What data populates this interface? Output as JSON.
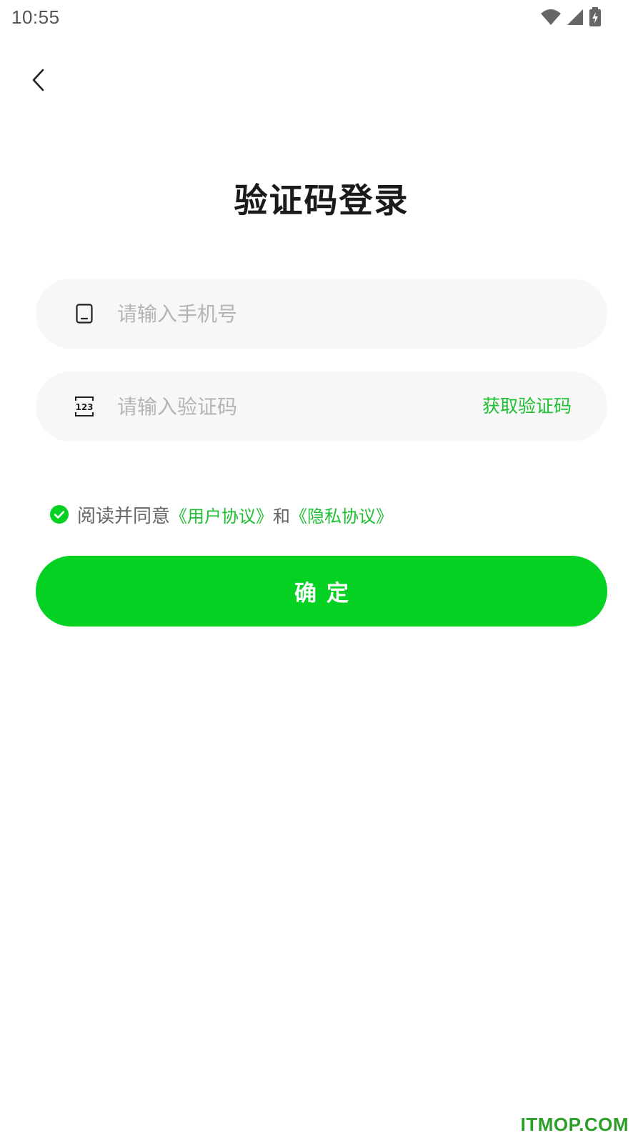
{
  "status_bar": {
    "time": "10:55",
    "icons": [
      "wifi-icon",
      "cellular-signal-icon",
      "battery-charging-icon"
    ]
  },
  "header": {
    "back_icon": "chevron-left-icon"
  },
  "title": "验证码登录",
  "phone_field": {
    "icon": "phone-icon",
    "placeholder": "请输入手机号",
    "value": ""
  },
  "code_field": {
    "icon": "numeric-123-icon",
    "placeholder": "请输入验证码",
    "value": "",
    "get_code_label": "获取验证码"
  },
  "agreement": {
    "checked": true,
    "prefix": "阅读并同意",
    "user_agreement": "《用户协议》",
    "and": "和",
    "privacy_agreement": "《隐私协议》"
  },
  "confirm_label": "确定",
  "watermark": "ITMOP.COM",
  "colors": {
    "accent": "#04d122",
    "link": "#1fc031",
    "field_bg": "#f7f7f7",
    "placeholder": "#b4b4b4"
  }
}
